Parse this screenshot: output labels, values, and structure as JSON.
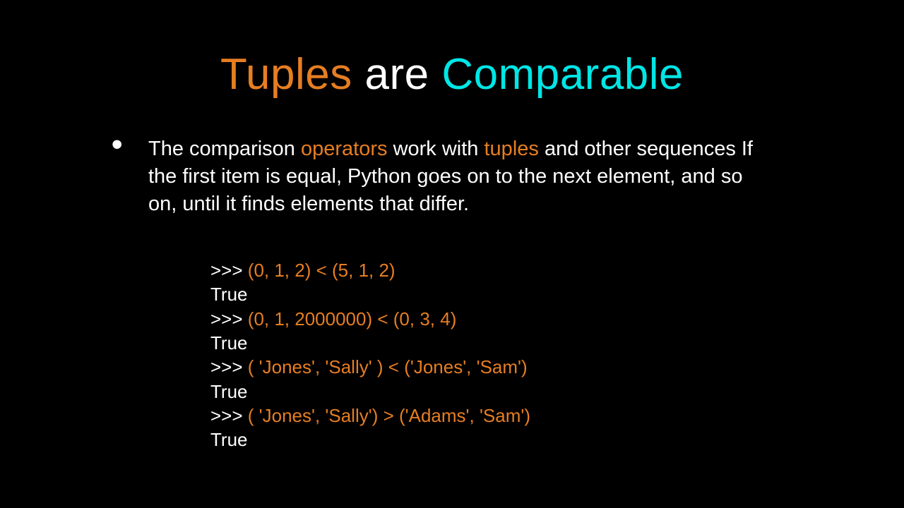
{
  "title": {
    "w1": "Tuples",
    "w2": " are ",
    "w3": "Comparable"
  },
  "para": {
    "p1": "The comparison ",
    "op": "operators",
    "p2": " work with ",
    "tp": "tuples",
    "p3": " and other sequences If the first item is equal, Python goes on to the next element,  and so on, until it finds elements that differ."
  },
  "code": {
    "prompt": ">>> ",
    "l1": "(0, 1, 2) < (5, 1, 2)",
    "r1": "True",
    "l2": "(0, 1, 2000000) < (0, 3, 4)",
    "r2": "True",
    "l3": "( 'Jones', 'Sally' ) < ('Jones', 'Sam')",
    "r3": "True",
    "l4": "( 'Jones', 'Sally') > ('Adams', 'Sam')",
    "r4": "True"
  }
}
